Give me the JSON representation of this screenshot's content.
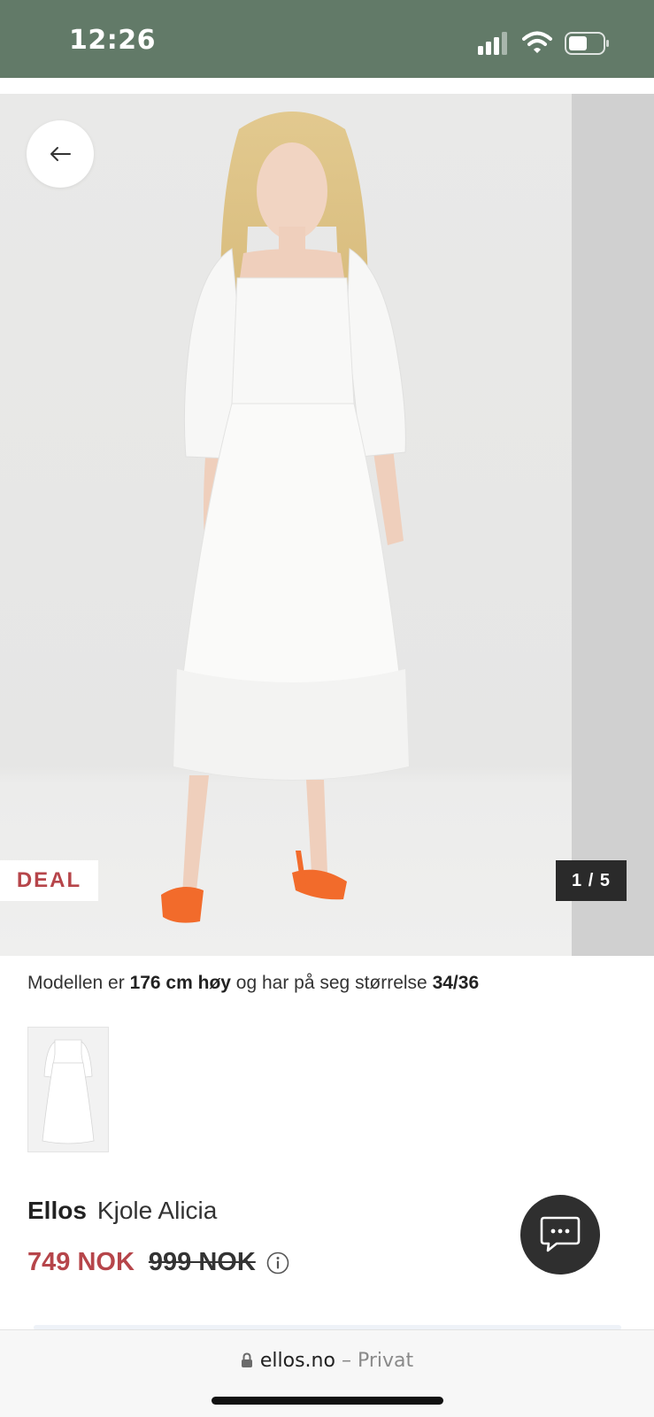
{
  "status_bar": {
    "time": "12:26",
    "icons": [
      "signal-icon",
      "wifi-icon",
      "battery-icon"
    ],
    "background": "#627a68"
  },
  "product_gallery": {
    "deal_label": "DEAL",
    "counter": "1 / 5",
    "back_icon": "arrow-left-icon"
  },
  "model_info": {
    "prefix": "Modellen er ",
    "height": "176 cm høy",
    "middle": " og har på seg størrelse ",
    "size": "34/36"
  },
  "product": {
    "brand": "Ellos",
    "name": "Kjole Alicia",
    "price": "749 NOK",
    "original_price": "999 NOK",
    "info_icon": "info-icon"
  },
  "chat": {
    "icon": "chat-bubble-icon"
  },
  "browser": {
    "domain": "ellos.no",
    "separator": "–",
    "mode": "Privat"
  },
  "colors": {
    "sale_red": "#b6454a",
    "dark": "#2a2a2a"
  }
}
